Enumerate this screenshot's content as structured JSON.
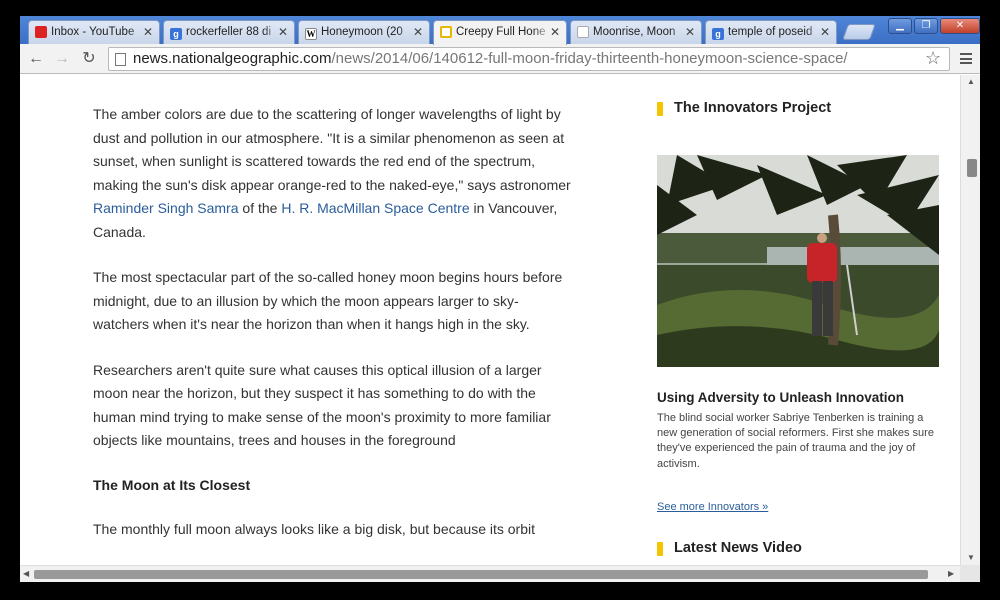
{
  "tabs": [
    {
      "title": "Inbox - YouTube",
      "favicon": "youtube-icon"
    },
    {
      "title": "rockerfeller 88 di",
      "favicon": "google-icon"
    },
    {
      "title": "Honeymoon (20",
      "favicon": "wikipedia-icon"
    },
    {
      "title": "Creepy Full Hone",
      "favicon": "document-icon",
      "active": true
    },
    {
      "title": "Moonrise, Moon",
      "favicon": "moon-icon"
    },
    {
      "title": "temple of poseid",
      "favicon": "google-icon"
    }
  ],
  "toolbar": {
    "url_domain": "news.nationalgeographic.com",
    "url_path": "/news/2014/06/140612-full-moon-friday-thirteenth-honeymoon-science-space/"
  },
  "article": {
    "p1_before_link1": "The amber colors are due to the scattering of longer wavelengths of light by dust and pollution in our atmosphere. \"It is a similar phenomenon as seen at sunset, when sunlight is scattered towards the red end of the spectrum, making the sun's disk appear orange-red to the naked-eye,\" says astronomer ",
    "p1_link1": "Raminder Singh Samra",
    "p1_between": " of the ",
    "p1_link2": "H. R. MacMillan Space Centre",
    "p1_after": " in Vancouver, Canada.",
    "p2": "The most spectacular part of the so-called honey moon begins hours before midnight, due to an illusion by which the moon appears larger to sky-watchers when it's near the horizon than when it hangs high in the sky.",
    "p3": "Researchers aren't quite sure what causes this optical illusion of a larger moon near the horizon, but they suspect it has something to do with the human mind trying to make sense of the moon's proximity to more familiar objects like mountains, trees and houses in the foreground",
    "subheading": "The Moon at Its Closest",
    "p4": "The monthly full moon always looks like a big disk, but because its orbit"
  },
  "sidebar": {
    "innovators_heading": "The Innovators Project",
    "caption_title": "Using Adversity to Unleash Innovation",
    "caption_text": "The blind social worker Sabriye Tenberken is training a new generation of social reformers. First she makes sure they've experienced the pain of trauma and the joy of activism.",
    "see_more": "See more Innovators »",
    "video_heading": "Latest News Video"
  },
  "colors": {
    "heading_bar": "#f5c400",
    "link": "#2a5d9a",
    "tabstrip": "#3b6fc4"
  }
}
